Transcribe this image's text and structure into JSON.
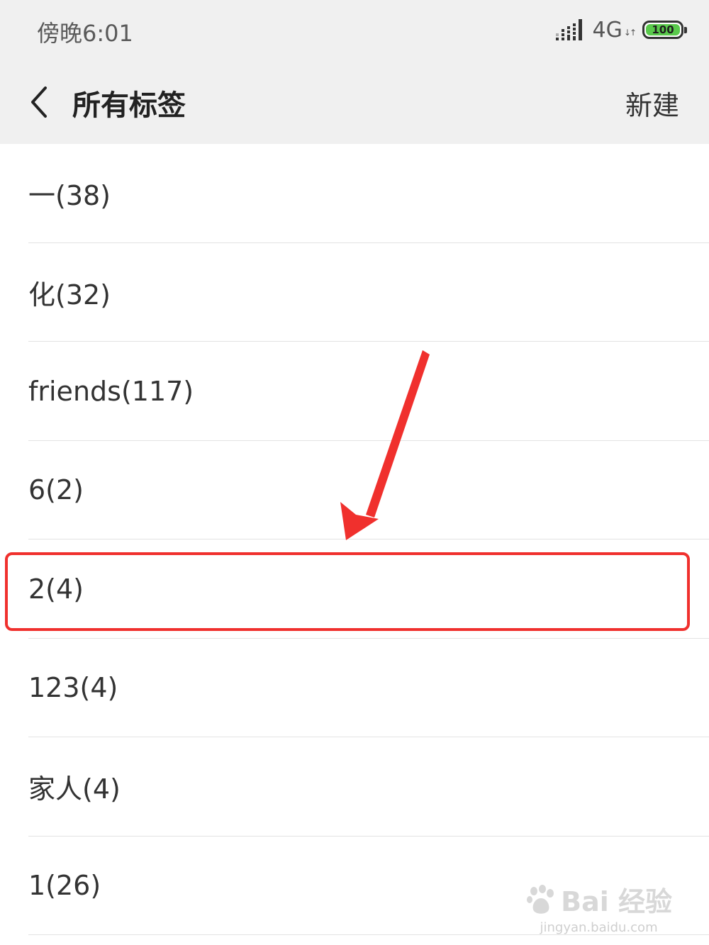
{
  "status_bar": {
    "time": "傍晚6:01",
    "network": "4G",
    "battery": "100"
  },
  "header": {
    "title": "所有标签",
    "new_label": "新建"
  },
  "tags": [
    {
      "label": "一(38)"
    },
    {
      "label": "化(32)"
    },
    {
      "label": "friends(117)"
    },
    {
      "label": "6(2)"
    },
    {
      "label": "2(4)"
    },
    {
      "label": "123(4)"
    },
    {
      "label": "家人(4)"
    },
    {
      "label": "1(26)"
    }
  ],
  "annotation": {
    "highlight_color": "#f0302d",
    "highlighted_tag_index": 4
  },
  "watermark": {
    "brand": "Bai 经验",
    "url": "jingyan.baidu.com"
  },
  "icons": [
    "signal-icon",
    "battery-icon",
    "back-arrow-icon",
    "paw-icon"
  ]
}
